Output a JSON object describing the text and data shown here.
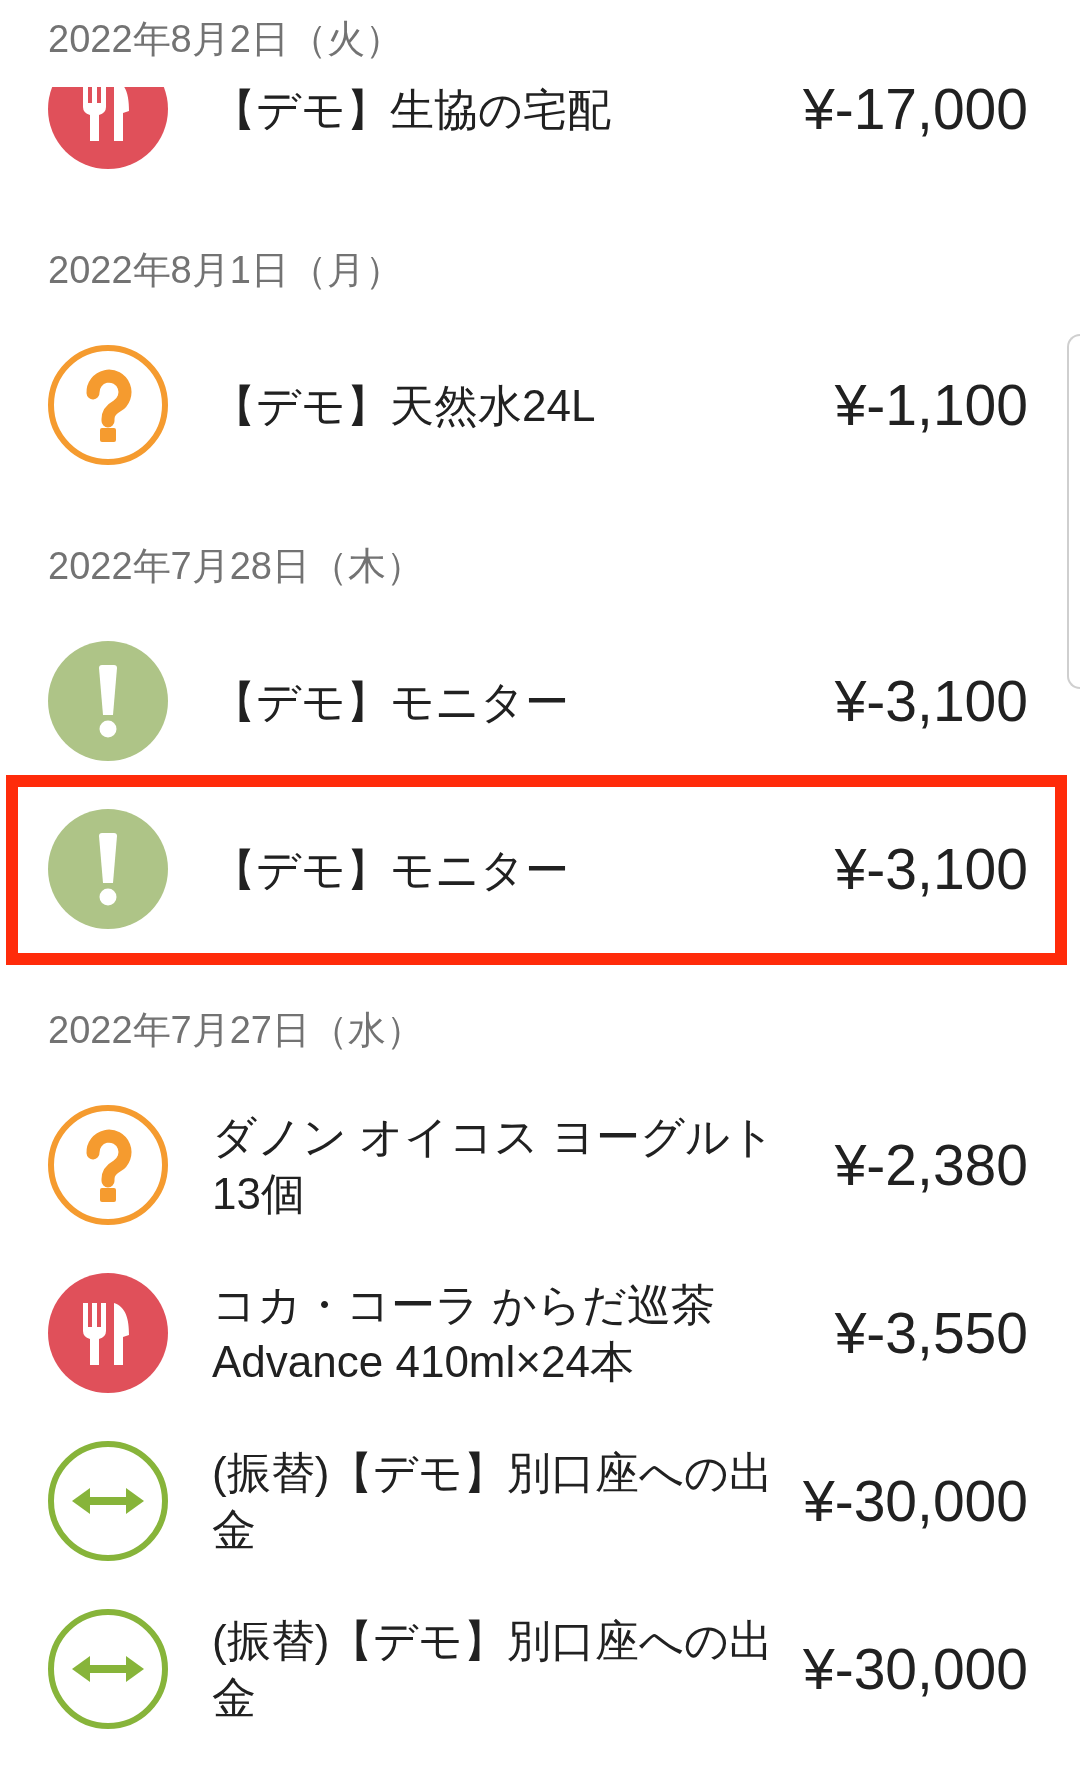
{
  "groups": [
    {
      "date": "2022年8月2日（火）",
      "items": [
        {
          "kind": "food",
          "name": "【デモ】生協の宅配",
          "amount": "¥-17,000",
          "highlighted": false
        }
      ]
    },
    {
      "date": "2022年8月1日（月）",
      "items": [
        {
          "kind": "unknown",
          "name": "【デモ】天然水24L",
          "amount": "¥-1,100",
          "highlighted": false
        }
      ]
    },
    {
      "date": "2022年7月28日（木）",
      "items": [
        {
          "kind": "alert",
          "name": "【デモ】モニター",
          "amount": "¥-3,100",
          "highlighted": false
        },
        {
          "kind": "alert",
          "name": "【デモ】モニター",
          "amount": "¥-3,100",
          "highlighted": true
        }
      ]
    },
    {
      "date": "2022年7月27日（水）",
      "items": [
        {
          "kind": "unknown",
          "name": "ダノン オイコス ヨーグルト 13個",
          "amount": "¥-2,380",
          "highlighted": false
        },
        {
          "kind": "food",
          "name": "コカ・コーラ からだ巡茶 Advance 410ml×24本",
          "amount": "¥-3,550",
          "highlighted": false
        },
        {
          "kind": "transfer",
          "name": "(振替)【デモ】別口座への出金",
          "amount": "¥-30,000",
          "highlighted": false
        },
        {
          "kind": "transfer",
          "name": "(振替)【デモ】別口座への出金",
          "amount": "¥-30,000",
          "highlighted": false
        }
      ]
    }
  ]
}
